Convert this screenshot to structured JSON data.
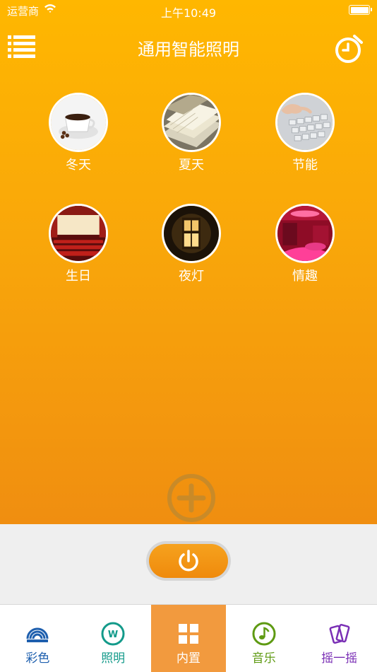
{
  "status_bar": {
    "carrier": "运营商",
    "time": "上午10:49"
  },
  "nav": {
    "title": "通用智能照明",
    "menu_icon": "list-icon",
    "timer_icon": "alarm-clock-icon"
  },
  "scenes": [
    {
      "label": "冬天",
      "icon": "coffee-cup-image"
    },
    {
      "label": "夏天",
      "icon": "books-image"
    },
    {
      "label": "节能",
      "icon": "keyboard-image"
    },
    {
      "label": "生日",
      "icon": "theater-image"
    },
    {
      "label": "夜灯",
      "icon": "lamp-image"
    },
    {
      "label": "情趣",
      "icon": "red-room-image"
    }
  ],
  "add_button": {
    "icon": "plus-circle-icon"
  },
  "power_button": {
    "icon": "power-icon"
  },
  "tabs": [
    {
      "label": "彩色",
      "icon": "rainbow-icon",
      "color": "#1e5fae",
      "active": false
    },
    {
      "label": "照明",
      "icon": "w-circle-icon",
      "color": "#139a8a",
      "active": false
    },
    {
      "label": "内置",
      "icon": "grid-icon",
      "color": "#ffffff",
      "active": true
    },
    {
      "label": "音乐",
      "icon": "music-note-icon",
      "color": "#5e9a12",
      "active": false
    },
    {
      "label": "摇一摇",
      "icon": "shake-phone-icon",
      "color": "#7a2fb5",
      "active": false
    }
  ],
  "colors": {
    "accent": "#f29a3e",
    "header_top": "#ffb700",
    "header_bottom": "#f08e10"
  }
}
